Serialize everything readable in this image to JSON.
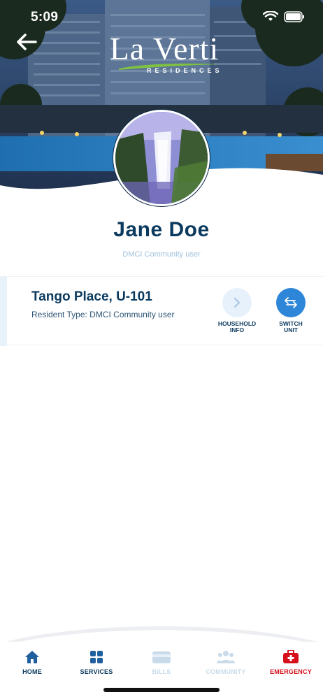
{
  "status_bar": {
    "time": "5:09"
  },
  "header": {
    "logo_main": "La Verti",
    "logo_sub": "RESIDENCES"
  },
  "profile": {
    "name": "Jane Doe",
    "role": "DMCI Community user"
  },
  "unit": {
    "title": "Tango Place, U-101",
    "resident_type": "Resident Type: DMCI Community user",
    "actions": [
      {
        "label_line1": "HOUSEHOLD",
        "label_line2": "INFO",
        "icon": "chevron-right-icon"
      },
      {
        "label_line1": "SWITCH",
        "label_line2": "UNIT",
        "icon": "switch-arrows-icon"
      }
    ]
  },
  "bottom_nav": {
    "items": [
      {
        "label": "HOME",
        "icon": "home-icon",
        "color": "#0b3a5e",
        "state": "active"
      },
      {
        "label": "SERVICES",
        "icon": "grid-icon",
        "color": "#0b3a5e",
        "state": "enabled"
      },
      {
        "label": "BILLS",
        "icon": "card-icon",
        "color": "#c9dbea",
        "state": "disabled"
      },
      {
        "label": "COMMUNITY",
        "icon": "people-icon",
        "color": "#c9dbea",
        "state": "disabled"
      },
      {
        "label": "EMERGENCY",
        "icon": "first-aid-icon",
        "color": "#d60f1a",
        "state": "enabled"
      }
    ]
  },
  "colors": {
    "primary": "#0b3a5e",
    "accent": "#2e86d8",
    "muted": "#9fc1dc",
    "emergency": "#d60f1a"
  }
}
